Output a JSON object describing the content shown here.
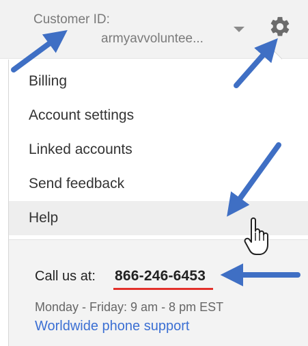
{
  "header": {
    "customer_id_label": "Customer ID:",
    "customer_id_value": "armyavvoluntee..."
  },
  "menu": {
    "items": [
      {
        "label": "Billing"
      },
      {
        "label": "Account settings"
      },
      {
        "label": "Linked accounts"
      },
      {
        "label": "Send feedback"
      },
      {
        "label": "Help"
      }
    ],
    "hovered_item": "Help"
  },
  "support": {
    "call_label": "Call us at:",
    "phone": "866-246-6453",
    "hours": "Monday - Friday: 9 am - 8 pm EST",
    "worldwide_link": "Worldwide phone support"
  },
  "icons": {
    "settings": "gear-icon",
    "dropdown": "chevron-down-icon",
    "cursor": "hand-pointer-icon"
  },
  "colors": {
    "arrow": "#3f6fc4",
    "phone_underline": "#e2302b",
    "link": "#3b6fd3",
    "hover_bg": "#eeeeee"
  }
}
